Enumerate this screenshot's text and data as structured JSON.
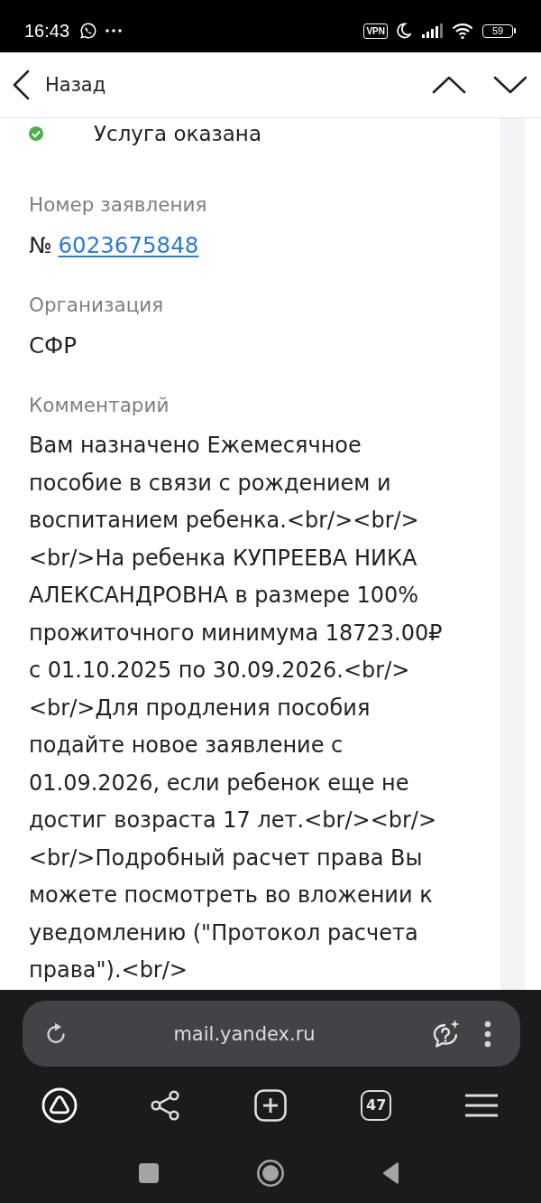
{
  "status_bar": {
    "time": "16:43",
    "vpn": "VPN",
    "battery": "59"
  },
  "header": {
    "back_label": "Назад"
  },
  "service_status": {
    "text": "Услуга оказана"
  },
  "fields": [
    {
      "kind": "link",
      "label": "Номер заявления",
      "prefix": "№",
      "value": "6023675848"
    },
    {
      "kind": "text",
      "label": "Организация",
      "value": "СФР"
    },
    {
      "kind": "paragraph",
      "label": "Комментарий",
      "value": "Вам назначено Ежемесячное пособие в связи с рождением и воспитанием ребенка.<br/><br/><br/>На ребенка КУПРЕЕВА НИКА АЛЕКСАНДРОВНА в размере 100% прожиточного минимума 18723.00₽ с 01.10.2025 по 30.09.2026.<br/><br/>Для продления пособия подайте новое заявление с 01.09.2026, если ребенок еще не достиг возраста 17 лет.<br/><br/><br/>Подробный расчет права Вы можете посмотреть во вложении к уведомлению (\"Протокол расчета права\").<br/>"
    }
  ],
  "browser": {
    "url": "mail.yandex.ru",
    "tab_count": "47"
  }
}
